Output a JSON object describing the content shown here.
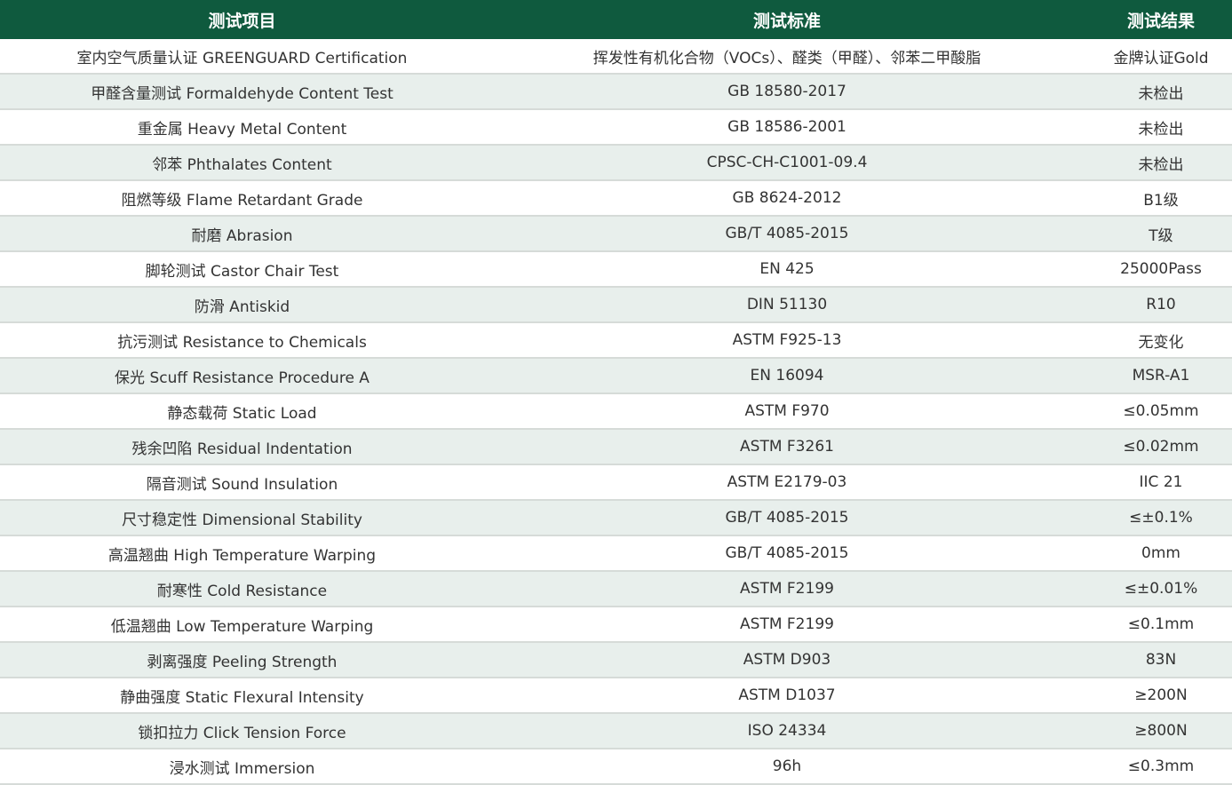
{
  "colors": {
    "header_bg": "#0f5a3e",
    "header_text": "#ffffff",
    "stripe_bg": "#e8efec",
    "row_border": "#d6dbd8",
    "body_text": "#333333"
  },
  "table": {
    "headers": [
      "测试项目",
      "测试标准",
      "测试结果"
    ],
    "rows": [
      [
        "室内空气质量认证 GREENGUARD Certification",
        "挥发性有机化合物（VOCs）、醛类（甲醛）、邻苯二甲酸脂",
        "金牌认证Gold"
      ],
      [
        "甲醛含量测试 Formaldehyde Content Test",
        "GB 18580-2017",
        "未检出"
      ],
      [
        "重金属 Heavy Metal Content",
        "GB 18586-2001",
        "未检出"
      ],
      [
        "邻苯 Phthalates Content",
        "CPSC-CH-C1001-09.4",
        "未检出"
      ],
      [
        "阻燃等级 Flame Retardant Grade",
        "GB 8624-2012",
        "B1级"
      ],
      [
        "耐磨 Abrasion",
        "GB/T 4085-2015",
        "T级"
      ],
      [
        "脚轮测试 Castor Chair Test",
        "EN 425",
        "25000Pass"
      ],
      [
        "防滑 Antiskid",
        "DIN 51130",
        "R10"
      ],
      [
        "抗污测试 Resistance to Chemicals",
        "ASTM F925-13",
        "无变化"
      ],
      [
        "保光 Scuff Resistance Procedure A",
        "EN 16094",
        "MSR-A1"
      ],
      [
        "静态载荷 Static Load",
        "ASTM F970",
        "≤0.05mm"
      ],
      [
        "残余凹陷 Residual Indentation",
        "ASTM F3261",
        "≤0.02mm"
      ],
      [
        "隔音测试 Sound Insulation",
        "ASTM E2179-03",
        "IIC 21"
      ],
      [
        "尺寸稳定性 Dimensional Stability",
        "GB/T 4085-2015",
        "≤±0.1%"
      ],
      [
        "高温翘曲 High Temperature Warping",
        "GB/T 4085-2015",
        "0mm"
      ],
      [
        "耐寒性 Cold Resistance",
        "ASTM F2199",
        "≤±0.01%"
      ],
      [
        "低温翘曲 Low Temperature Warping",
        "ASTM F2199",
        "≤0.1mm"
      ],
      [
        "剥离强度 Peeling Strength",
        "ASTM D903",
        "83N"
      ],
      [
        "静曲强度 Static Flexural Intensity",
        "ASTM D1037",
        "≥200N"
      ],
      [
        "锁扣拉力 Click Tension Force",
        "ISO 24334",
        "≥800N"
      ],
      [
        "浸水测试 Immersion",
        "96h",
        "≤0.3mm"
      ]
    ]
  }
}
